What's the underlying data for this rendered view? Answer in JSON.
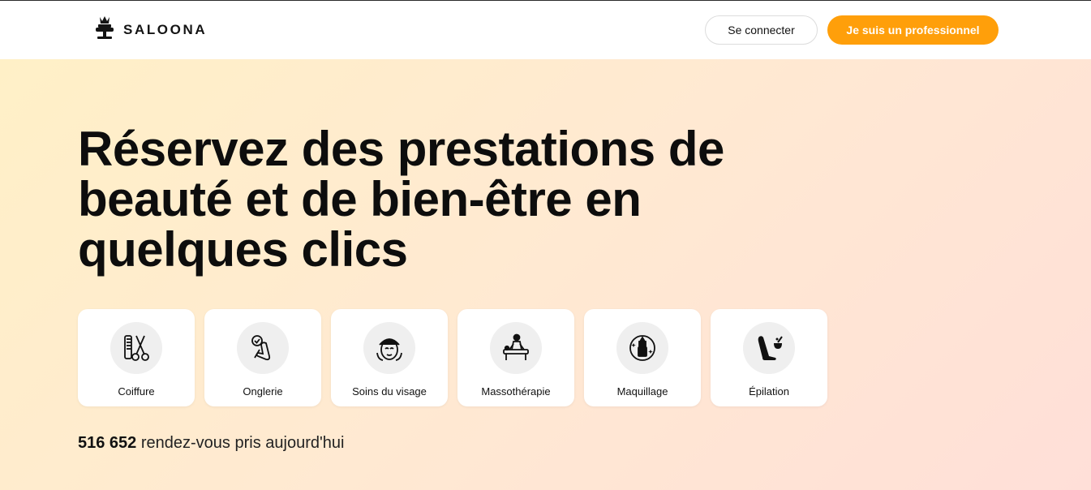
{
  "header": {
    "logo_text": "SALOONA",
    "login_label": "Se connecter",
    "pro_label": "Je suis un professionnel",
    "accent_color": "#ff9f0a"
  },
  "hero": {
    "title": "Réservez des prestations de beauté et de bien-être en quelques clics",
    "categories": [
      {
        "label": "Coiffure",
        "icon": "scissors-comb-icon"
      },
      {
        "label": "Onglerie",
        "icon": "nail-hand-icon"
      },
      {
        "label": "Soins du visage",
        "icon": "face-care-icon"
      },
      {
        "label": "Massothérapie",
        "icon": "massage-icon"
      },
      {
        "label": "Maquillage",
        "icon": "lipstick-icon"
      },
      {
        "label": "Épilation",
        "icon": "leg-wax-icon"
      }
    ],
    "stat_count": "516 652",
    "stat_text": "rendez-vous pris aujourd'hui"
  }
}
